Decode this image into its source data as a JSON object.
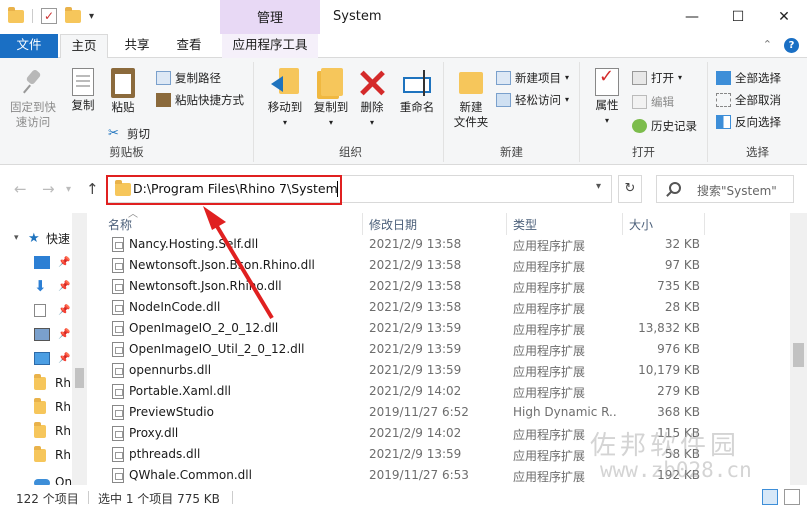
{
  "titlebar": {
    "manage_tab": "管理",
    "title": "System",
    "qa_dropdown": "▾",
    "minimize": "—",
    "maximize": "☐",
    "close": "✕"
  },
  "tabs": {
    "file": "文件",
    "home": "主页",
    "share": "共享",
    "view": "查看",
    "app_tools": "应用程序工具",
    "expand": "⌃"
  },
  "ribbon": {
    "clipboard": {
      "pin": "固定到快速访问",
      "copy": "复制",
      "paste": "粘贴",
      "copy_path": "复制路径",
      "paste_shortcut": "粘贴快捷方式",
      "cut": "剪切",
      "label": "剪贴板"
    },
    "organize": {
      "move_to": "移动到",
      "copy_to": "复制到",
      "delete": "删除",
      "rename": "重命名",
      "label": "组织"
    },
    "new": {
      "new_folder": "新建\n文件夹",
      "new_item": "新建项目",
      "easy_access": "轻松访问",
      "label": "新建"
    },
    "open": {
      "properties": "属性",
      "open": "打开",
      "edit": "编辑",
      "history": "历史记录",
      "label": "打开"
    },
    "select": {
      "select_all": "全部选择",
      "select_none": "全部取消",
      "invert": "反向选择",
      "label": "选择"
    }
  },
  "address": {
    "path": "D:\\Program Files\\Rhino 7\\System",
    "search_placeholder": "搜索\"System\""
  },
  "nav": {
    "quick_access": "快速",
    "items": [
      "Rh",
      "Rh",
      "Rh",
      "Rh"
    ],
    "bottom": "On"
  },
  "columns": {
    "name": "名称",
    "date": "修改日期",
    "type": "类型",
    "size": "大小"
  },
  "files": [
    {
      "name": "Nancy.Hosting.Self.dll",
      "date": "2021/2/9 13:58",
      "type": "应用程序扩展",
      "size": "32 KB"
    },
    {
      "name": "Newtonsoft.Json.Bson.Rhino.dll",
      "date": "2021/2/9 13:58",
      "type": "应用程序扩展",
      "size": "97 KB"
    },
    {
      "name": "Newtonsoft.Json.Rhino.dll",
      "date": "2021/2/9 13:58",
      "type": "应用程序扩展",
      "size": "735 KB"
    },
    {
      "name": "NodeInCode.dll",
      "date": "2021/2/9 13:58",
      "type": "应用程序扩展",
      "size": "28 KB"
    },
    {
      "name": "OpenImageIO_2_0_12.dll",
      "date": "2021/2/9 13:59",
      "type": "应用程序扩展",
      "size": "13,832 KB"
    },
    {
      "name": "OpenImageIO_Util_2_0_12.dll",
      "date": "2021/2/9 13:59",
      "type": "应用程序扩展",
      "size": "976 KB"
    },
    {
      "name": "opennurbs.dll",
      "date": "2021/2/9 13:59",
      "type": "应用程序扩展",
      "size": "10,179 KB"
    },
    {
      "name": "Portable.Xaml.dll",
      "date": "2021/2/9 14:02",
      "type": "应用程序扩展",
      "size": "279 KB"
    },
    {
      "name": "PreviewStudio",
      "date": "2019/11/27 6:52",
      "type": "High Dynamic R...",
      "size": "368 KB"
    },
    {
      "name": "Proxy.dll",
      "date": "2021/2/9 14:02",
      "type": "应用程序扩展",
      "size": "115 KB"
    },
    {
      "name": "pthreads.dll",
      "date": "2021/2/9 13:59",
      "type": "应用程序扩展",
      "size": "58 KB"
    },
    {
      "name": "QWhale.Common.dll",
      "date": "2019/11/27 6:53",
      "type": "应用程序扩展",
      "size": "192 KB"
    }
  ],
  "status": {
    "count": "122 个项目",
    "selected": "选中 1 个项目  775 KB"
  },
  "watermark": {
    "line1": "佐邦软件园",
    "line2": "www.zb028.cn"
  }
}
